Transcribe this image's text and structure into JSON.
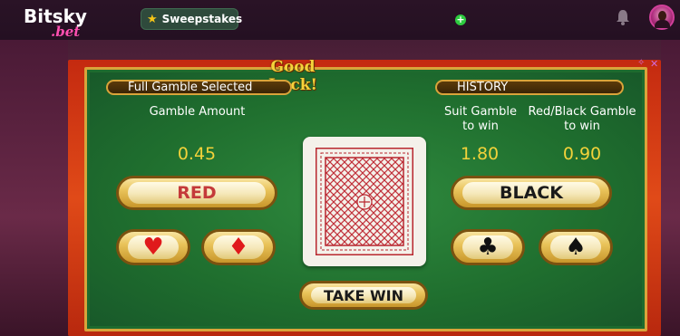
{
  "header": {
    "logo_top": "Bitsky",
    "logo_bottom": ".bet",
    "sweepstakes_label": "Sweepstakes",
    "plus_label": "+"
  },
  "game": {
    "title": "Good Luck!",
    "mode_label": "Full Gamble Selected",
    "history_label": "HISTORY",
    "gamble_amount_label": "Gamble Amount",
    "suit_gamble_label": "Suit Gamble\nto win",
    "red_black_label": "Red/Black Gamble\nto win",
    "gamble_amount_value": "0.45",
    "suit_gamble_value": "1.80",
    "red_black_value": "0.90",
    "red_button": "RED",
    "black_button": "BLACK",
    "take_win_button": "TAKE WIN",
    "suits": [
      "♥",
      "♦",
      "♣",
      "♠"
    ],
    "close_label": "✕"
  },
  "colors": {
    "table_green": "#1f6e2e",
    "frame_red": "#d63a14",
    "gold": "#d9a43a",
    "value_yellow": "#f2d23a"
  }
}
